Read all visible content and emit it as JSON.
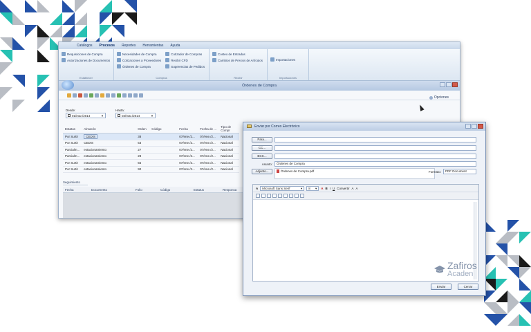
{
  "app": {
    "menu": [
      "Catálogos",
      "Procesos",
      "Reportes",
      "Herramientas",
      "Ayuda"
    ],
    "menu_active": "Procesos",
    "ribbon": {
      "establecer": {
        "items": [
          "Requisiciones de Compra",
          "Autorizaciones de Documentos"
        ],
        "label": "Establecer"
      },
      "compras": {
        "items": [
          "Necesidades de Compra",
          "Cotizaciones a Proveedores",
          "Órdenes de Compra",
          "Cotizador de Compras",
          "Recibir CFD",
          "Sugerencias de Pedidos"
        ],
        "label": "Compras"
      },
      "recibir": {
        "items": [
          "Costeo de Entradas",
          "Cambios de Precios de Artículos"
        ],
        "label": "Recibir"
      },
      "importaciones": {
        "items": [
          "Importaciones"
        ],
        "label": "Importaciones"
      }
    }
  },
  "orders_window": {
    "title": "Órdenes de Compra",
    "options_label": "Opciones",
    "desde_label": "Desde:",
    "desde_value": "01/mar./2014",
    "hasta_label": "Hasta:",
    "hasta_value": "03/mar./2014",
    "columns": [
      "Estatus",
      "Almacén",
      "Orden",
      "Código",
      "Fecha",
      "Fecha de ...",
      "Tipo de Compr"
    ],
    "rows": [
      {
        "estatus": "Por Surtir",
        "almacen": "CEDIS",
        "orden": "38",
        "codigo": "",
        "fecha": "07/ene./2...",
        "fecha2": "07/ene./2...",
        "tipo": "Nacional"
      },
      {
        "estatus": "Por Surtir",
        "almacen": "CEDIS",
        "orden": "53",
        "codigo": "",
        "fecha": "07/ene./2...",
        "fecha2": "07/ene./2...",
        "tipo": "Nacional"
      },
      {
        "estatus": "Parcialm...",
        "almacen": "estacionamiento",
        "orden": "27",
        "codigo": "",
        "fecha": "07/ene./2...",
        "fecha2": "07/ene./2...",
        "tipo": "Nacional"
      },
      {
        "estatus": "Parcialm...",
        "almacen": "estacionamiento",
        "orden": "28",
        "codigo": "",
        "fecha": "07/ene./2...",
        "fecha2": "07/ene./2...",
        "tipo": "Nacional"
      },
      {
        "estatus": "Por Surtir",
        "almacen": "estacionamiento",
        "orden": "55",
        "codigo": "",
        "fecha": "07/ene./2...",
        "fecha2": "07/ene./2...",
        "tipo": "Nacional"
      },
      {
        "estatus": "Por Surtir",
        "almacen": "estacionamiento",
        "orden": "90",
        "codigo": "",
        "fecha": "07/ene./2...",
        "fecha2": "07/ene./2...",
        "tipo": "Nacional"
      }
    ],
    "seguimiento_label": "Seguimiento",
    "seguimiento_columns": [
      "Fecha",
      "Documento",
      "Folio",
      "Código",
      "Estatus",
      "Responsa"
    ]
  },
  "email": {
    "title": "Enviar por Correo Electrónico",
    "para_label": "Para...",
    "cc_label": "CC...",
    "bcc_label": "BCC...",
    "asunto_label": "Asunto:",
    "asunto_value": "Órdenes de Compra",
    "adjunto_label": "Adjunto...",
    "adjunto_value": "Órdenes de Compra.pdf",
    "formato_label": "Formato:",
    "formato_value": "PDF Document",
    "font_name": "Microsoft Sans Serif",
    "font_size": "8",
    "convertir_label": "Convertir",
    "enviar_label": "Enviar",
    "cerrar_label": "Cerrar"
  },
  "watermark": {
    "line1": "Zafiros",
    "line2": "Acaden"
  },
  "colors": {
    "deco_blue": "#2452a8",
    "deco_teal": "#27c1b3",
    "deco_grey": "#b9bdc4",
    "deco_black": "#1a1a1a"
  }
}
